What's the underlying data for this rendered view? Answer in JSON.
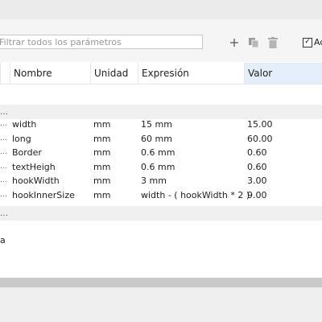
{
  "search": {
    "placeholder": "Filtrar todos los parámetros"
  },
  "toolbar": {
    "add_icon": "plus-icon",
    "copy_icon": "copy-icon",
    "delete_icon": "trash-icon",
    "checkbox_label": "Ac",
    "checkbox_checked": true
  },
  "columns": {
    "name": "Nombre",
    "unit": "Unidad",
    "expression": "Expresión",
    "value": "Valor"
  },
  "group_markers": {
    "first": "…",
    "second": "…"
  },
  "row_marker": "…",
  "rows": [
    {
      "name": "width",
      "unit": "mm",
      "expression": "15 mm",
      "value": "15.00"
    },
    {
      "name": "long",
      "unit": "mm",
      "expression": "60 mm",
      "value": "60.00"
    },
    {
      "name": "Border",
      "unit": "mm",
      "expression": "0.6 mm",
      "value": "0.60"
    },
    {
      "name": "textHeigh",
      "unit": "mm",
      "expression": "0.6 mm",
      "value": "0.60"
    },
    {
      "name": "hookWidth",
      "unit": "mm",
      "expression": "3 mm",
      "value": "3.00"
    },
    {
      "name": "hookInnerSize",
      "unit": "mm",
      "expression": "width - ( hookWidth * 2 )",
      "value": "9.00"
    }
  ],
  "misc_row": {
    "label": "a"
  },
  "colors": {
    "sorted_header": "#e3eefa",
    "group_band": "#f0f0f0",
    "bottom_bar": "#c9c9c9"
  }
}
